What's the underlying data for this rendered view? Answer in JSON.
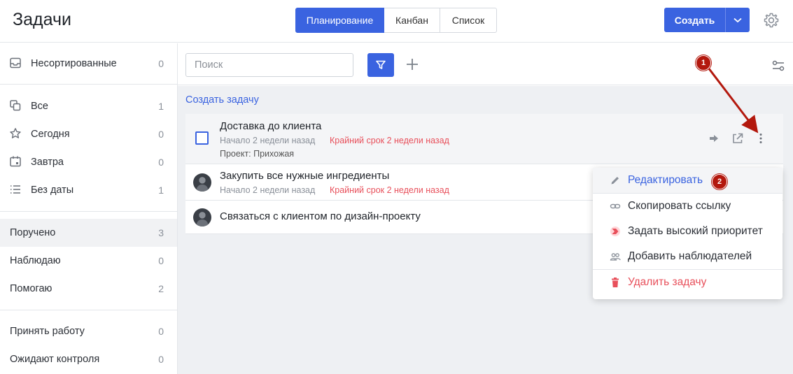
{
  "header": {
    "title": "Задачи",
    "views": [
      "Планирование",
      "Канбан",
      "Список"
    ],
    "active_view": "Планирование",
    "create_label": "Создать"
  },
  "sidebar": {
    "inbox": {
      "label": "Несортированные",
      "count": "0"
    },
    "filters": [
      {
        "label": "Все",
        "count": "1",
        "icon": "copy-icon"
      },
      {
        "label": "Сегодня",
        "count": "0",
        "icon": "star-icon"
      },
      {
        "label": "Завтра",
        "count": "0",
        "icon": "calendar-icon"
      },
      {
        "label": "Без даты",
        "count": "1",
        "icon": "list-icon"
      }
    ],
    "roles": [
      {
        "label": "Поручено",
        "count": "3",
        "selected": true
      },
      {
        "label": "Наблюдаю",
        "count": "0"
      },
      {
        "label": "Помогаю",
        "count": "2"
      }
    ],
    "control": [
      {
        "label": "Принять работу",
        "count": "0"
      },
      {
        "label": "Ожидают контроля",
        "count": "0"
      }
    ]
  },
  "toolbar": {
    "search_placeholder": "Поиск"
  },
  "main": {
    "create_task_link": "Создать задачу",
    "tasks": [
      {
        "title": "Доставка до клиента",
        "start": "Начало 2 недели назад",
        "deadline": "Крайний срок 2 недели назад",
        "project": "Проект: Прихожая"
      },
      {
        "title": "Закупить все нужные ингредиенты",
        "start": "Начало 2 недели назад",
        "deadline": "Крайний срок 2 недели назад"
      },
      {
        "title": "Связаться с клиентом по дизайн-проекту"
      }
    ]
  },
  "context_menu": {
    "items": [
      {
        "label": "Редактировать",
        "icon": "pencil-icon"
      },
      {
        "label": "Скопировать ссылку",
        "icon": "link-icon"
      },
      {
        "label": "Задать высокий приоритет",
        "icon": "priority-icon"
      },
      {
        "label": "Добавить наблюдателей",
        "icon": "users-icon"
      },
      {
        "label": "Удалить задачу",
        "icon": "trash-icon"
      }
    ]
  },
  "annotations": {
    "badge_1": "1",
    "badge_2": "2"
  },
  "colors": {
    "accent": "#3a63e0",
    "danger": "#e8505b",
    "badge": "#b3180d"
  }
}
